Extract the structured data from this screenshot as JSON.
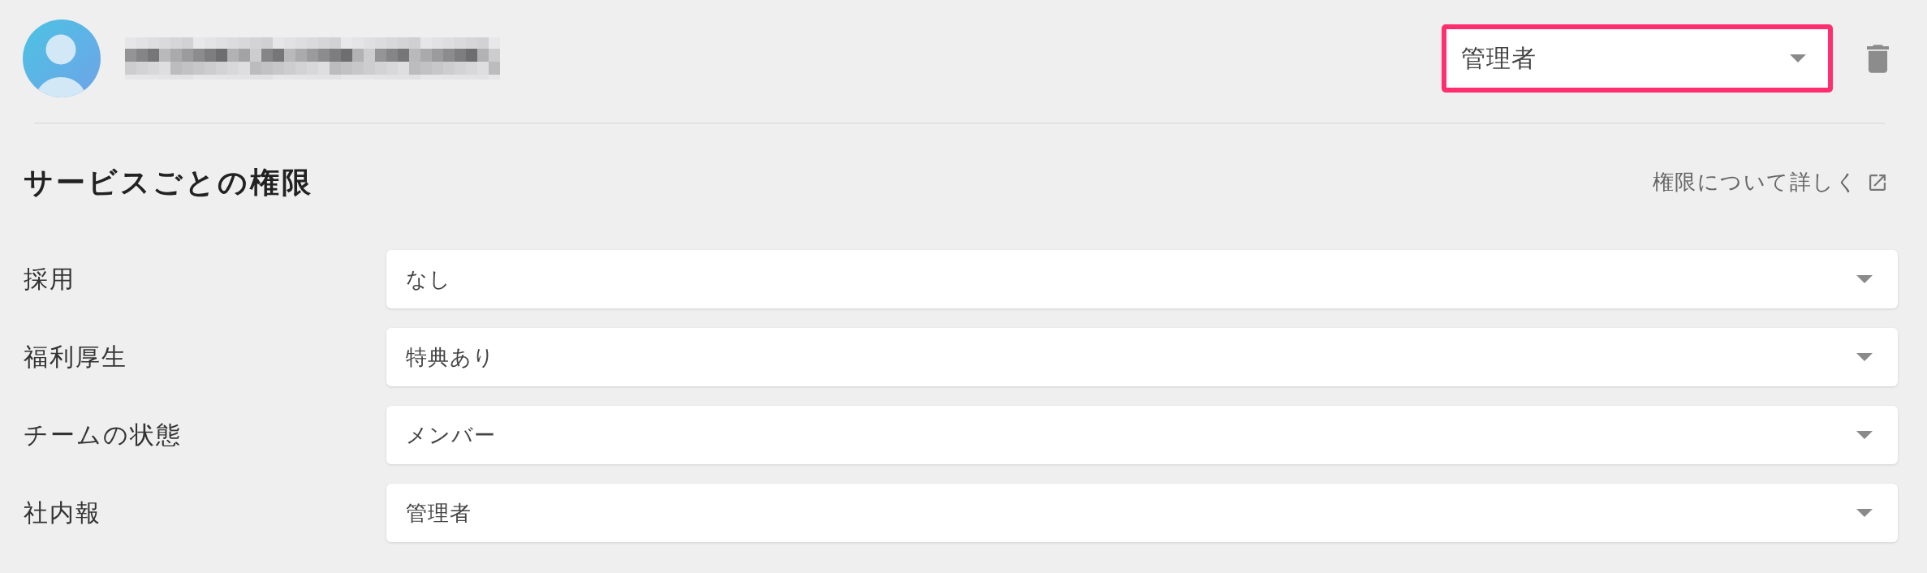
{
  "user": {
    "role_select": {
      "value": "管理者",
      "highlighted": true
    }
  },
  "permissions": {
    "title": "サービスごとの権限",
    "help_link": "権限について詳しく",
    "services": [
      {
        "label": "採用",
        "value": "なし"
      },
      {
        "label": "福利厚生",
        "value": "特典あり"
      },
      {
        "label": "チームの状態",
        "value": "メンバー"
      },
      {
        "label": "社内報",
        "value": "管理者"
      }
    ]
  }
}
